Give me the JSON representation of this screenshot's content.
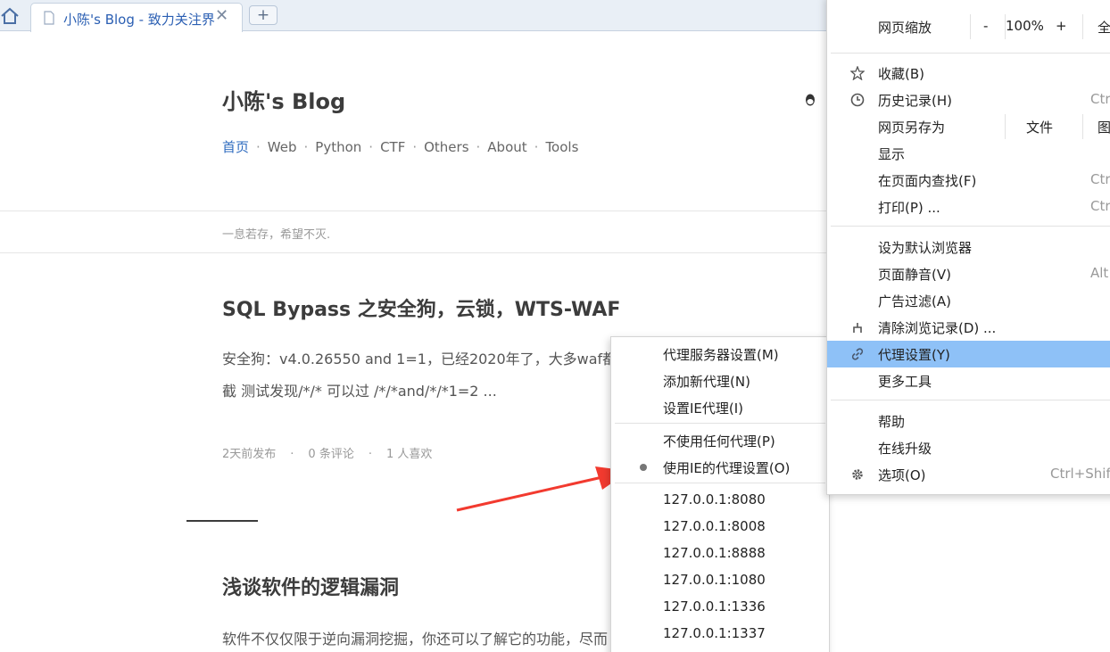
{
  "browser": {
    "tab_title": "小陈's Blog - 致力关注界",
    "new_tab": "+",
    "close": "✕"
  },
  "blog": {
    "title": "小陈's Blog",
    "nav": [
      "首页",
      "Web",
      "Python",
      "CTF",
      "Others",
      "About",
      "Tools"
    ],
    "motto": "一息若存，希望不灭.",
    "post1": {
      "title": "SQL Bypass 之安全狗，云锁，WTS-WAF",
      "excerpt_line1": "安全狗：v4.0.26550 and 1=1，已经2020年了，大多waf都",
      "excerpt_line2": "截 测试发现/*/* 可以过  /*/*and/*/*1=2 ...",
      "time": "2天前发布",
      "comments": "0 条评论",
      "likes": "1 人喜欢"
    },
    "post2": {
      "title": "浅谈软件的逻辑漏洞",
      "excerpt": "软件不仅仅限于逆向漏洞挖掘，你还可以了解它的功能，尽而                               解，因"
    }
  },
  "main_menu": {
    "zoom_label": "网页缩放",
    "zoom_minus": "-",
    "zoom_value": "100%",
    "zoom_plus": "+",
    "fullscreen": "全",
    "favorites": "收藏(B)",
    "history": "历史记录(H)",
    "history_shortcut": "Ctr",
    "save_as": "网页另存为",
    "save_file": "文件",
    "save_image": "图",
    "display": "显示",
    "find": "在页面内查找(F)",
    "find_shortcut": "Ctr",
    "print": "打印(P) ...",
    "print_shortcut": "Ctr",
    "set_default": "设为默认浏览器",
    "mute": "页面静音(V)",
    "mute_shortcut": "Alt",
    "adblock": "广告过滤(A)",
    "clear_history": "清除浏览记录(D) ...",
    "proxy": "代理设置(Y)",
    "more_tools": "更多工具",
    "help": "帮助",
    "upgrade": "在线升级",
    "options": "选项(O)",
    "options_shortcut": "Ctrl+Shift"
  },
  "proxy_menu": {
    "server_settings": "代理服务器设置(M)",
    "add_proxy": "添加新代理(N)",
    "ie_proxy": "设置IE代理(I)",
    "no_proxy": "不使用任何代理(P)",
    "use_ie": "使用IE的代理设置(O)",
    "proxies": [
      "127.0.0.1:8080",
      "127.0.0.1:8008",
      "127.0.0.1:8888",
      "127.0.0.1:1080",
      "127.0.0.1:1336",
      "127.0.0.1:1337"
    ]
  },
  "colors": {
    "highlight": "#8ec1f7",
    "link": "#2e6bbf",
    "arrow": "#f23a2f"
  }
}
